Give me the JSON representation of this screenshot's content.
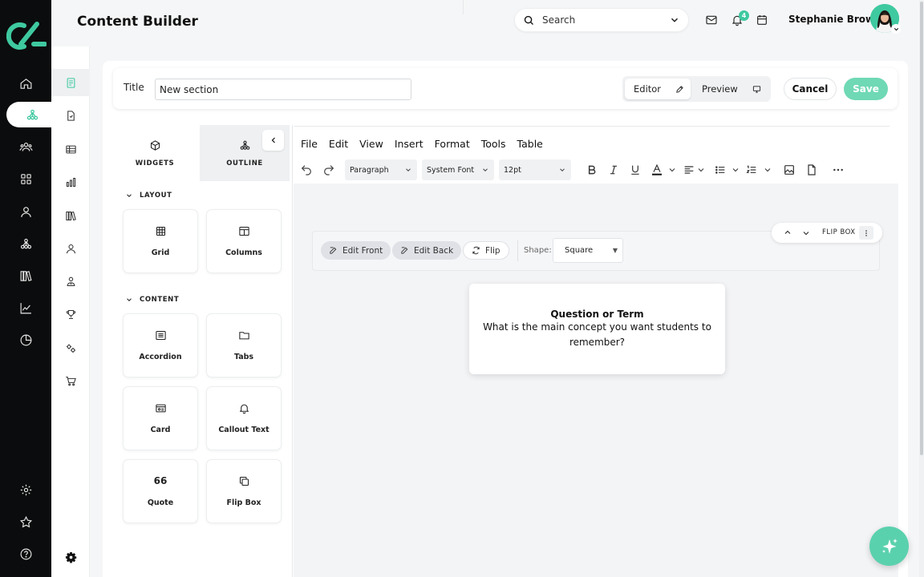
{
  "header": {
    "page_title": "Content Builder",
    "search_label": "Search",
    "notification_count": "4",
    "user_name": "Stephanie Brown"
  },
  "titlebar": {
    "title_label": "Title",
    "title_value": "New section",
    "editor_label": "Editor",
    "preview_label": "Preview",
    "cancel_label": "Cancel",
    "save_label": "Save"
  },
  "panel": {
    "widgets_tab": "WIDGETS",
    "outline_tab": "OUTLINE",
    "layout_heading": "LAYOUT",
    "content_heading": "CONTENT",
    "layout_items": [
      "Grid",
      "Columns"
    ],
    "content_items": [
      "Accordion",
      "Tabs",
      "Card",
      "Callout Text",
      "Quote",
      "Flip Box"
    ],
    "quote_glyph": "66"
  },
  "editor": {
    "menu": [
      "File",
      "Edit",
      "View",
      "Insert",
      "Format",
      "Tools",
      "Table"
    ],
    "block_format": "Paragraph",
    "font_family": "System Font",
    "font_size": "12pt"
  },
  "flipbox": {
    "edit_front": "Edit Front",
    "edit_back": "Edit Back",
    "flip": "Flip",
    "shape_label": "Shape:",
    "shape_value": "Square",
    "pill_label": "FLIP BOX",
    "card_title": "Question or Term",
    "card_body": "What is the main concept you want students to remember?"
  },
  "colors": {
    "accent": "#3fc9a0",
    "save_button": "#6fd8b5",
    "rail": "#0b0c0d"
  }
}
